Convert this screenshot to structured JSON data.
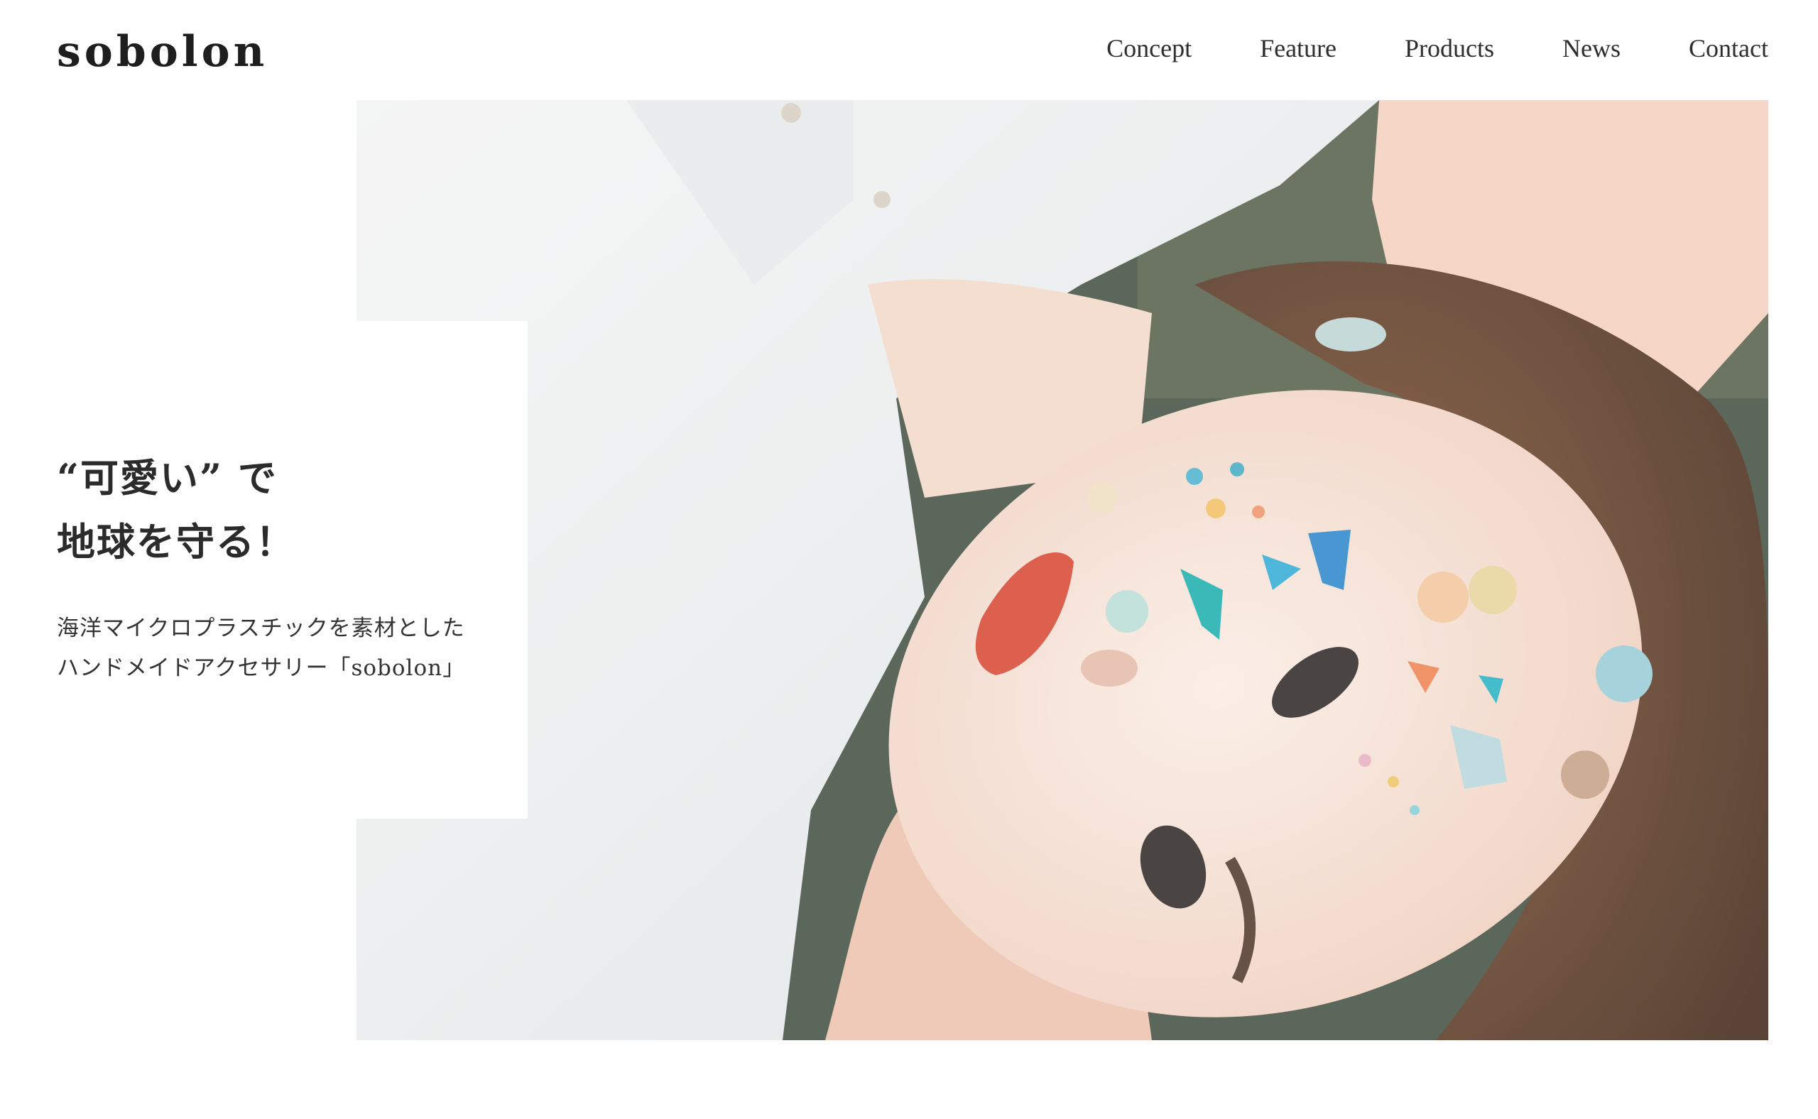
{
  "brand": {
    "logo_text": "sobolon"
  },
  "nav": {
    "items": [
      {
        "label": "Concept"
      },
      {
        "label": "Feature"
      },
      {
        "label": "Products"
      },
      {
        "label": "News"
      },
      {
        "label": "Contact"
      }
    ]
  },
  "hero": {
    "headline_line1": "“可愛い” で",
    "headline_line2": "地球を守る！",
    "lead_line1": "海洋マイクロプラスチックを素材とした",
    "lead_line2": "ハンドメイドアクセサリー「sobolon」"
  },
  "colors": {
    "text": "#2a2a2a",
    "background": "#ffffff"
  }
}
